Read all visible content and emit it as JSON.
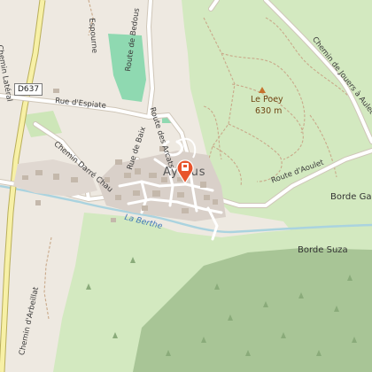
{
  "map": {
    "place_label": "Aydius",
    "peak": {
      "name": "Le Poey",
      "elevation": "630 m"
    },
    "roads": {
      "d637_shield": "D637",
      "rue_espiate": "Rue d'Espiate",
      "route_bedous": "Route de Bedous",
      "route_arcats": "Route des Arcats",
      "rue_baix": "Rue de Baix",
      "chemin_darre_chau": "Chemin Darré Chau",
      "route_aoulet": "Route d'Aoulet",
      "chemin_lateral": "Chemin Latéral",
      "chemin_jouers": "Chemin de Jouers à Aulet",
      "chemin_arbeillat": "Chemin d'Arbeillat",
      "partial_espourne": "Espourne"
    },
    "places": {
      "borde_gale": "Borde Gale",
      "borde_suza": "Borde Suza"
    },
    "water": {
      "river_name": "La Berthe"
    },
    "colors": {
      "background": "#eee9e1",
      "forest": "#d3e9c0",
      "forest_dark": "#a8c596",
      "water": "#aad3df",
      "pitch": "#8fd9b1",
      "main_road": "#f7f0a6",
      "marker": "#e8542c"
    },
    "icons": {
      "marker": "map-pin-icon",
      "peak": "peak-triangle-icon",
      "tree": "tree-icon"
    }
  }
}
